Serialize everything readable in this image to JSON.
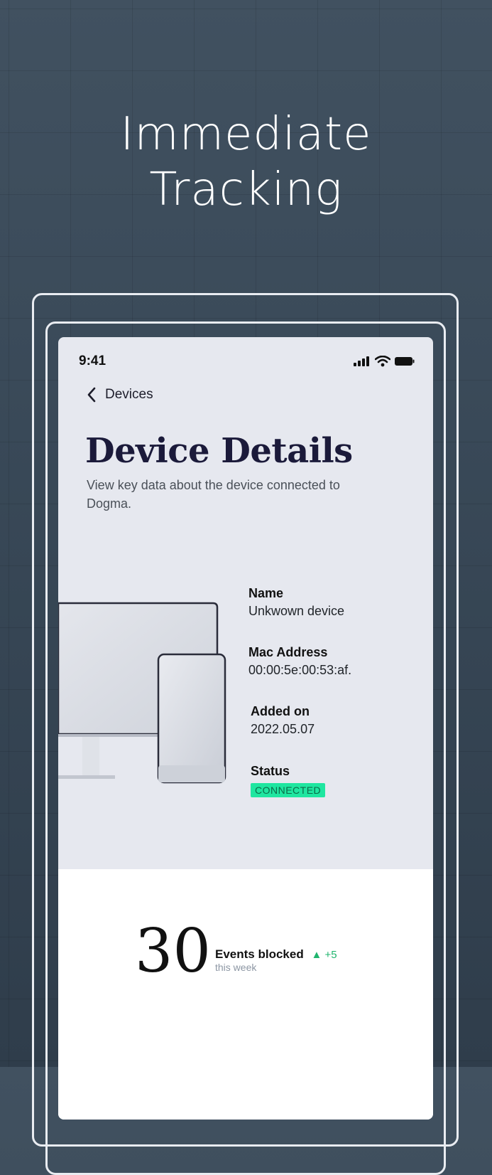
{
  "hero": {
    "line1": "Immediate",
    "line2": "Tracking"
  },
  "status_bar": {
    "time": "9:41"
  },
  "nav": {
    "back_label": "Devices"
  },
  "page": {
    "title": "Device Details",
    "subtitle": "View key data about the device connected to Dogma."
  },
  "details": {
    "name_label": "Name",
    "name_value": "Unkwown device",
    "mac_label": "Mac Address",
    "mac_value": "00:00:5e:00:53:af.",
    "added_label": "Added on",
    "added_value": "2022.05.07",
    "status_label": "Status",
    "status_value": "CONNECTED"
  },
  "stats": {
    "count": "30",
    "label": "Events blocked",
    "delta": "+5",
    "period": "this week"
  },
  "colors": {
    "background": "#3a4a59",
    "screen": "#e6e8ef",
    "title": "#1b1a3a",
    "badge_bg": "#1fe6a0",
    "badge_text": "#0b6b48",
    "delta": "#20b56e"
  }
}
